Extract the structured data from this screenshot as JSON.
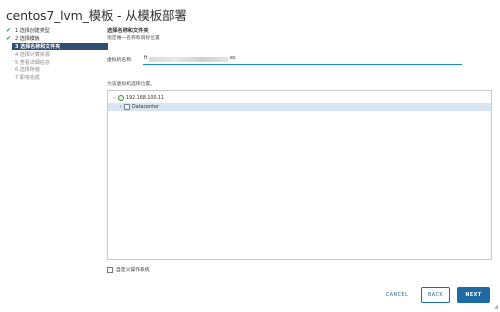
{
  "dialog": {
    "title": "centos7_lvm_模板 - 从模板部署"
  },
  "steps": [
    {
      "label": "1 选择创建类型",
      "state": "done"
    },
    {
      "label": "2 选择模板",
      "state": "done"
    },
    {
      "label": "3 选择名称和文件夹",
      "state": "active"
    },
    {
      "label": "4 选择计算资源",
      "state": "pending"
    },
    {
      "label": "5 查看详细信息",
      "state": "pending"
    },
    {
      "label": "6 选择存储",
      "state": "pending"
    },
    {
      "label": "7 即将完成",
      "state": "pending"
    }
  ],
  "content": {
    "section_title": "选择名称和文件夹",
    "section_subtitle": "指定唯一名称和目标位置",
    "vm_name_label": "虚拟机名称:",
    "vm_name_prefix": "ft",
    "vm_name_suffix": "es",
    "location_label": "为该虚拟机选择位置。",
    "tree": {
      "root_label": "192.168.100.11",
      "root_icon": "vcenter-icon",
      "child_label": "Datacenter",
      "child_icon": "datacenter-icon"
    },
    "custom_os_label": "自定义操作系统"
  },
  "buttons": {
    "cancel": "CANCEL",
    "back": "BACK",
    "next": "NEXT"
  },
  "colors": {
    "active_step_bg": "#2f4f74",
    "check_green": "#2e8b3a",
    "primary_blue": "#1d6aa5",
    "selected_row_bg": "#d7e5f1"
  }
}
